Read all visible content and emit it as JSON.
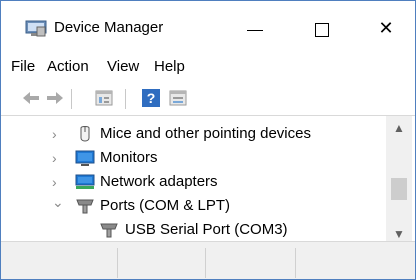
{
  "window": {
    "title": "Device Manager",
    "close_glyph": "✕",
    "app_icon": "device-manager-icon"
  },
  "menu": {
    "items": [
      "File",
      "Action",
      "View",
      "Help"
    ]
  },
  "toolbar": {
    "icons": [
      "back-arrow-icon",
      "forward-arrow-icon",
      "properties-icon",
      "help-icon",
      "view-icon"
    ]
  },
  "tree": {
    "items": [
      {
        "label": "Mice and other pointing devices",
        "expander": "›",
        "icon": "mouse-icon"
      },
      {
        "label": "Monitors",
        "expander": "›",
        "icon": "monitor-icon"
      },
      {
        "label": "Network adapters",
        "expander": "›",
        "icon": "network-adapter-icon"
      },
      {
        "label": "Ports (COM & LPT)",
        "expander": "⌄",
        "icon": "port-icon"
      },
      {
        "label": "USB Serial Port (COM3)",
        "expander": "",
        "icon": "port-icon"
      }
    ]
  },
  "scrollbar": {
    "up": "▲",
    "down": "▼"
  },
  "colors": {
    "border": "#4f7fbf",
    "accent_blue": "#1e78d4",
    "status_bg": "#f0f0f0"
  }
}
